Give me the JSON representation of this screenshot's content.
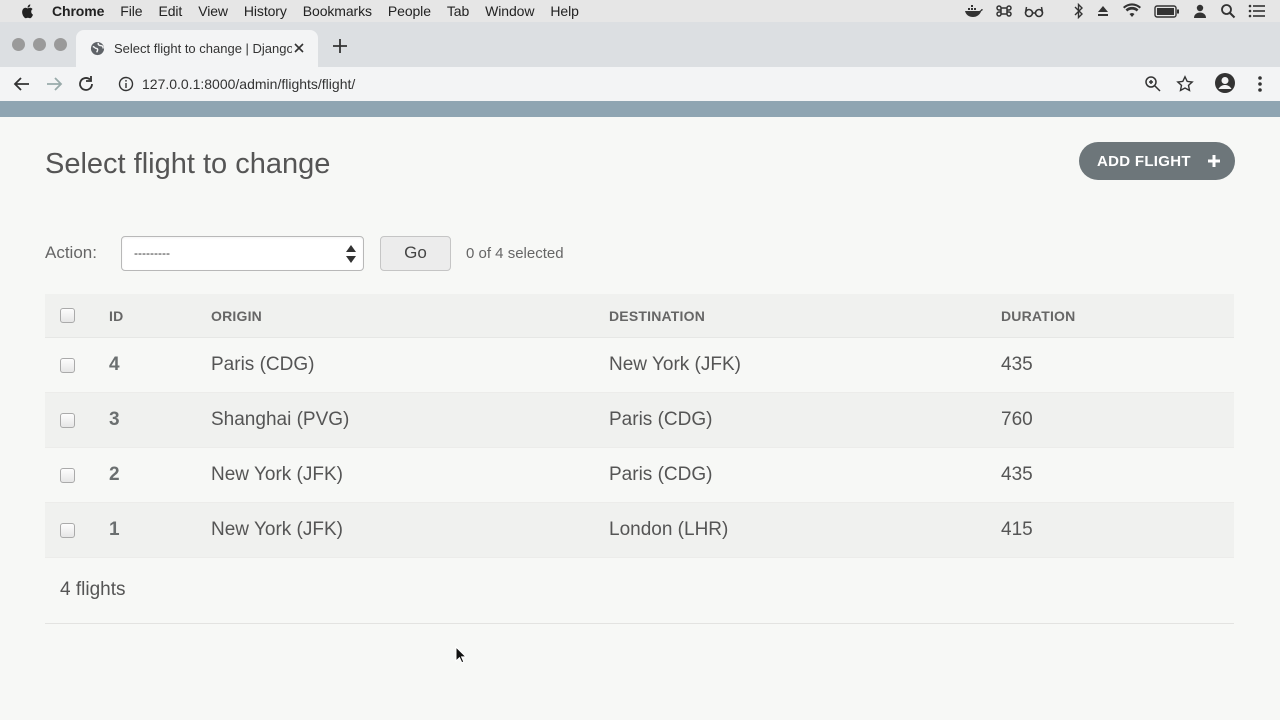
{
  "menubar": {
    "app": "Chrome",
    "items": [
      "File",
      "Edit",
      "View",
      "History",
      "Bookmarks",
      "People",
      "Tab",
      "Window",
      "Help"
    ]
  },
  "browser": {
    "tab_title": "Select flight to change | Django site admin",
    "url": "127.0.0.1:8000/admin/flights/flight/"
  },
  "page": {
    "title": "Select flight to change",
    "add_button": "ADD FLIGHT",
    "action_label": "Action:",
    "action_select_value": "---------",
    "go_button": "Go",
    "selected_count": "0 of 4 selected",
    "footer_count": "4 flights"
  },
  "table": {
    "headers": {
      "id": "ID",
      "origin": "ORIGIN",
      "destination": "DESTINATION",
      "duration": "DURATION"
    },
    "rows": [
      {
        "id": "4",
        "origin": "Paris (CDG)",
        "destination": "New York (JFK)",
        "duration": "435"
      },
      {
        "id": "3",
        "origin": "Shanghai (PVG)",
        "destination": "Paris (CDG)",
        "duration": "760"
      },
      {
        "id": "2",
        "origin": "New York (JFK)",
        "destination": "Paris (CDG)",
        "duration": "435"
      },
      {
        "id": "1",
        "origin": "New York (JFK)",
        "destination": "London (LHR)",
        "duration": "415"
      }
    ]
  },
  "colors": {
    "django_header": "#8fa5b2",
    "add_button_bg": "#6d767a",
    "page_bg": "#f7f8f6"
  },
  "icons": [
    "apple-icon",
    "docker-icon",
    "command-icon",
    "glasses-icon",
    "bluetooth-icon",
    "eject-icon",
    "wifi-icon",
    "battery-icon",
    "user-icon",
    "spotlight-icon",
    "notification-center-icon",
    "globe-favicon",
    "close-icon",
    "plus-icon",
    "back-icon",
    "forward-icon",
    "reload-icon",
    "info-icon",
    "zoom-icon",
    "star-icon",
    "profile-icon",
    "kebab-menu-icon"
  ]
}
